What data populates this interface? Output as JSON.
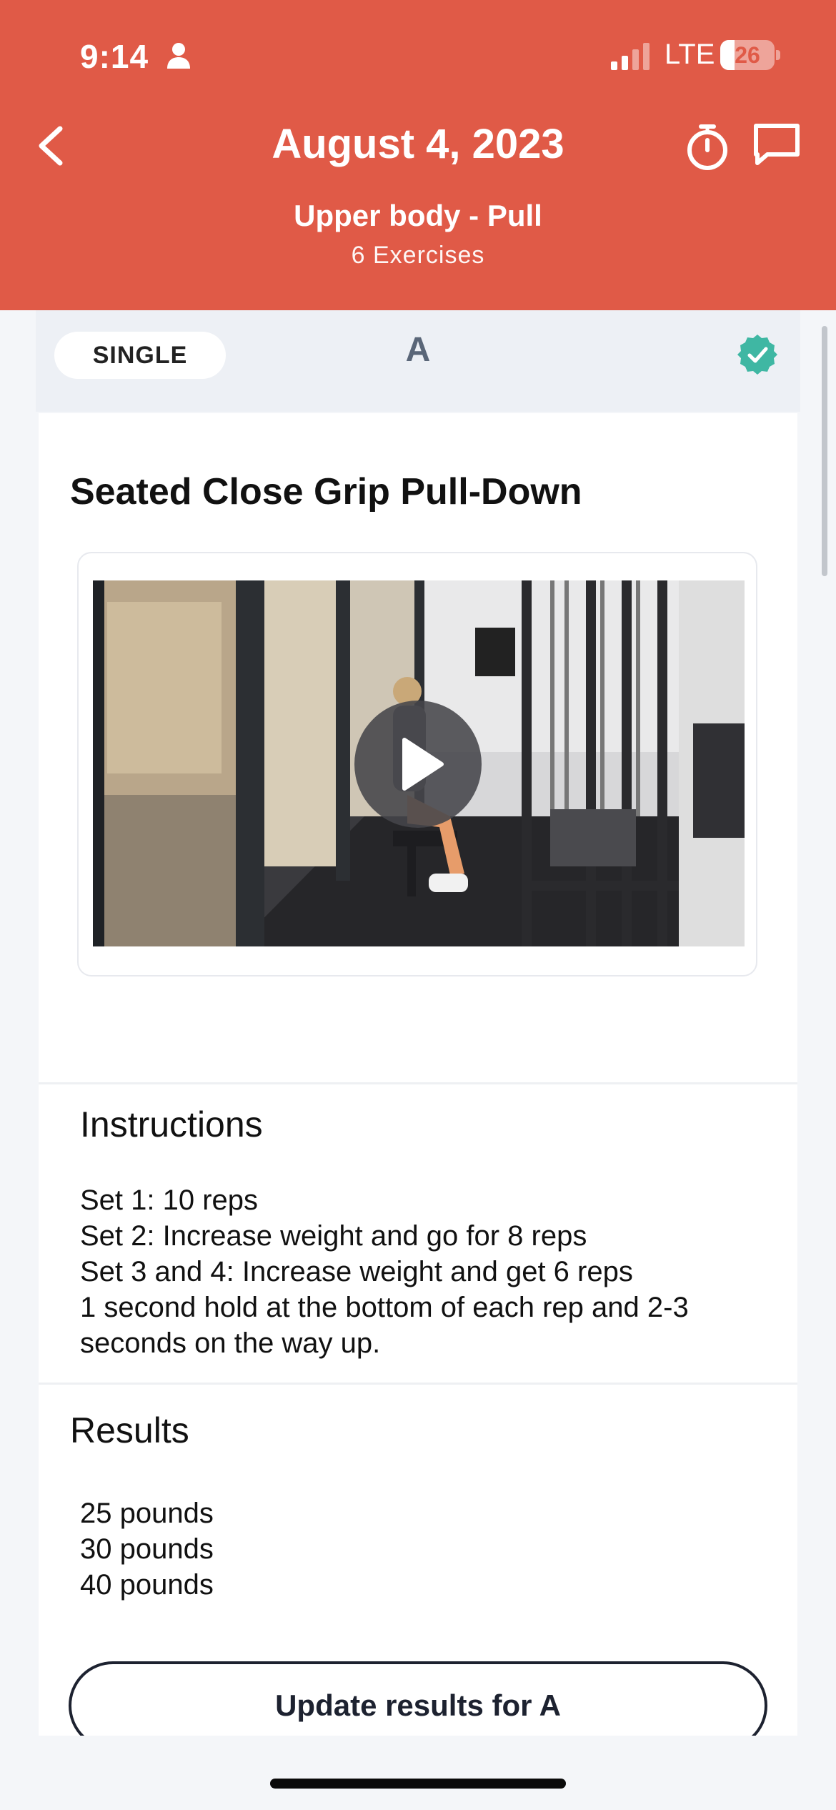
{
  "status_bar": {
    "time": "9:14",
    "network": "LTE",
    "battery_level": "26",
    "battery_fraction": 0.26
  },
  "header": {
    "title": "August 4, 2023",
    "subtitle": "Upper body - Pull",
    "exercise_count": "6 Exercises",
    "icons": [
      "chevron-left-icon",
      "stopwatch-icon",
      "chat-bubble-icon"
    ]
  },
  "section": {
    "type_label": "SINGLE",
    "letter": "A",
    "completed": true
  },
  "exercise": {
    "title": "Seated Close Grip Pull-Down"
  },
  "instructions": {
    "heading": "Instructions",
    "lines": [
      "Set 1: 10 reps",
      "Set 2: Increase weight and go for 8 reps",
      "Set 3 and 4: Increase weight and get 6 reps",
      "1 second hold at the bottom of each rep and 2-3",
      "seconds on the way up."
    ]
  },
  "results": {
    "heading": "Results",
    "lines": [
      "25 pounds",
      "30 pounds",
      "40 pounds"
    ],
    "update_button_label": "Update results for A"
  },
  "colors": {
    "header_bg": "#e05a47",
    "check_badge": "#3fb7a3",
    "button_border": "#1d2230"
  }
}
